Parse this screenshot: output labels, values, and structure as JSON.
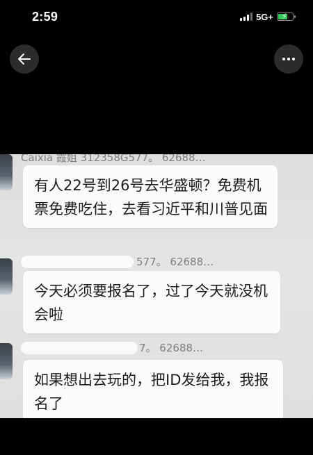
{
  "status_bar": {
    "time": "2:59",
    "network": "5G+",
    "battery_level": 0.6,
    "signal_bars": 3
  },
  "controls": {
    "back_icon": "arrow-left-icon",
    "more_icon": "more-horizontal-icon"
  },
  "messages": [
    {
      "sender": "Caixia 霞姐 312358G577。 62688…",
      "text": "有人22号到26号去华盛顿？免费机票免费吃住，去看习近平和川普见面"
    },
    {
      "sender": "577。 62688…",
      "text": "今天必须要报名了，过了今天就没机会啦"
    },
    {
      "sender": "7。 62688…",
      "text": "如果想出去玩的，把ID发给我，我报名了"
    }
  ],
  "colors": {
    "background": "#000000",
    "bubble": "#fbfbfb",
    "chat_bg": "#e0e0e0",
    "battery_fill": "#34c759"
  }
}
